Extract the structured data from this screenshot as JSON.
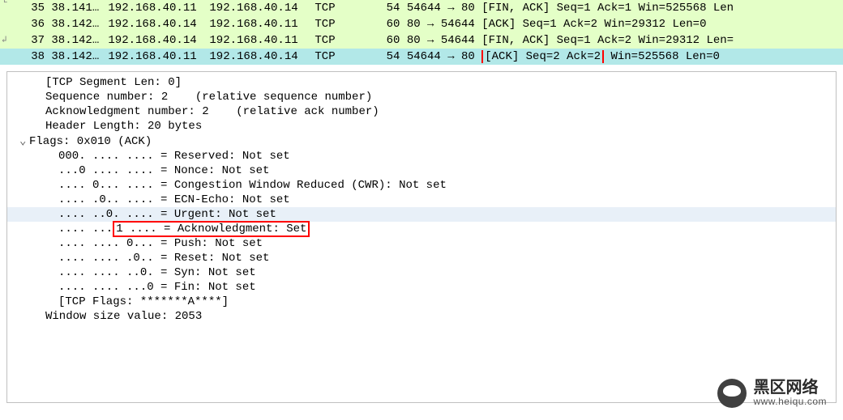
{
  "packets": [
    {
      "no": "35",
      "time": "38.141…",
      "src": "192.168.40.11",
      "dst": "192.168.40.14",
      "proto": "TCP",
      "len": "54",
      "info_pre": "54644 → 80 [FIN, ACK] Seq=1 Ack=1 Win=525568 Len",
      "class": "row-green"
    },
    {
      "no": "36",
      "time": "38.142…",
      "src": "192.168.40.14",
      "dst": "192.168.40.11",
      "proto": "TCP",
      "len": "60",
      "info_pre": "80 → 54644 [ACK] Seq=1 Ack=2 Win=29312 Len=0",
      "class": "row-green"
    },
    {
      "no": "37",
      "time": "38.142…",
      "src": "192.168.40.14",
      "dst": "192.168.40.11",
      "proto": "TCP",
      "len": "60",
      "info_pre": "80 → 54644 [FIN, ACK] Seq=1 Ack=2 Win=29312 Len=",
      "class": "row-green"
    },
    {
      "no": "38",
      "time": "38.142…",
      "src": "192.168.40.11",
      "dst": "192.168.40.14",
      "proto": "TCP",
      "len": "54",
      "info_pre": "54644 → 80 ",
      "info_hl": "[ACK] Seq=2 Ack=2",
      "info_post": " Win=525568 Len=0",
      "class": "row-selected"
    }
  ],
  "details": {
    "tcp_seg_len": "[TCP Segment Len: 0]",
    "seq": "Sequence number: 2    (relative sequence number)",
    "ack": "Acknowledgment number: 2    (relative ack number)",
    "hlen": "Header Length: 20 bytes",
    "flags": "Flags: 0x010 (ACK)",
    "reserved": "000. .... .... = Reserved: Not set",
    "nonce": "...0 .... .... = Nonce: Not set",
    "cwr": ".... 0... .... = Congestion Window Reduced (CWR): Not set",
    "ecn": ".... .0.. .... = ECN-Echo: Not set",
    "urg": ".... ..0. .... = Urgent: Not set",
    "ackflag_pre": ".... ...",
    "ackflag_hl": "1 .... = Acknowledgment: Set",
    "psh": ".... .... 0... = Push: Not set",
    "rst": ".... .... .0.. = Reset: Not set",
    "syn": ".... .... ..0. = Syn: Not set",
    "fin": ".... .... ...0 = Fin: Not set",
    "tcpflags": "[TCP Flags: *******A****]",
    "winsize": "Window size value: 2053"
  },
  "watermark": {
    "main": "黑区网络",
    "sub": "www.heiqu.com"
  }
}
